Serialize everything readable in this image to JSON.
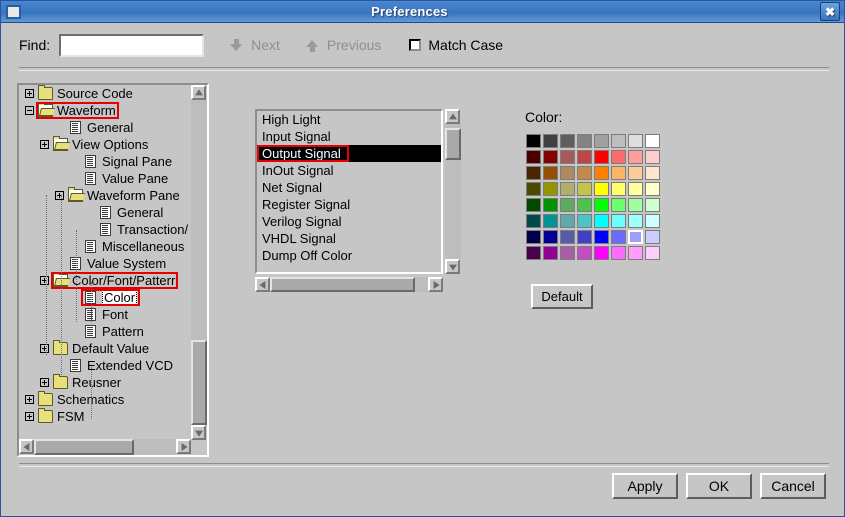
{
  "window": {
    "title": "Preferences",
    "close_label": "✖"
  },
  "findbar": {
    "find_label": "Find:",
    "find_value": "",
    "find_placeholder": "",
    "next_label": "Next",
    "previous_label": "Previous",
    "match_case_label": "Match Case",
    "match_case_checked": false
  },
  "tree": {
    "items": [
      {
        "label": "Source Code",
        "depth": 0,
        "expander": "plus",
        "icon": "folder",
        "selected": false,
        "red_box": false
      },
      {
        "label": "Waveform",
        "depth": 0,
        "expander": "minus",
        "icon": "folderopen",
        "selected": false,
        "red_box": true
      },
      {
        "label": "General",
        "depth": 2,
        "expander": "none",
        "icon": "doc",
        "selected": false,
        "red_box": false
      },
      {
        "label": "View Options",
        "depth": 1,
        "expander": "plus",
        "icon": "folderopen",
        "selected": false,
        "red_box": false
      },
      {
        "label": "Signal Pane",
        "depth": 3,
        "expander": "none",
        "icon": "doc",
        "selected": false,
        "red_box": false
      },
      {
        "label": "Value Pane",
        "depth": 3,
        "expander": "none",
        "icon": "doc",
        "selected": false,
        "red_box": false
      },
      {
        "label": "Waveform Pane",
        "depth": 2,
        "expander": "plus",
        "icon": "folderopen",
        "selected": false,
        "red_box": false
      },
      {
        "label": "General",
        "depth": 4,
        "expander": "none",
        "icon": "doc",
        "selected": false,
        "red_box": false
      },
      {
        "label": "Transaction/",
        "depth": 4,
        "expander": "none",
        "icon": "doc",
        "selected": false,
        "red_box": false
      },
      {
        "label": "Miscellaneous",
        "depth": 3,
        "expander": "none",
        "icon": "doc",
        "selected": false,
        "red_box": false
      },
      {
        "label": "Value System",
        "depth": 2,
        "expander": "none",
        "icon": "doc",
        "selected": false,
        "red_box": false
      },
      {
        "label": "Color/Font/Patterr",
        "depth": 1,
        "expander": "plus",
        "icon": "folderopen",
        "selected": false,
        "red_box": true
      },
      {
        "label": "Color",
        "depth": 3,
        "expander": "none",
        "icon": "doc",
        "selected": true,
        "red_box": true
      },
      {
        "label": "Font",
        "depth": 3,
        "expander": "none",
        "icon": "doc",
        "selected": false,
        "red_box": false
      },
      {
        "label": "Pattern",
        "depth": 3,
        "expander": "none",
        "icon": "doc",
        "selected": false,
        "red_box": false
      },
      {
        "label": "Default Value",
        "depth": 1,
        "expander": "plus",
        "icon": "folder",
        "selected": false,
        "red_box": false
      },
      {
        "label": "Extended VCD",
        "depth": 2,
        "expander": "none",
        "icon": "doc",
        "selected": false,
        "red_box": false
      },
      {
        "label": "Reusner",
        "depth": 1,
        "expander": "plus",
        "icon": "folder",
        "selected": false,
        "red_box": false
      },
      {
        "label": "Schematics",
        "depth": 0,
        "expander": "plus",
        "icon": "folder",
        "selected": false,
        "red_box": false
      },
      {
        "label": "FSM",
        "depth": 0,
        "expander": "plus",
        "icon": "folder",
        "selected": false,
        "red_box": false
      }
    ]
  },
  "list": {
    "items": [
      {
        "label": "High Light",
        "selected": false,
        "red_box": false
      },
      {
        "label": "Input Signal",
        "selected": false,
        "red_box": false
      },
      {
        "label": "Output Signal",
        "selected": true,
        "red_box": true
      },
      {
        "label": "InOut Signal",
        "selected": false,
        "red_box": false
      },
      {
        "label": "Net Signal",
        "selected": false,
        "red_box": false
      },
      {
        "label": "Register Signal",
        "selected": false,
        "red_box": false
      },
      {
        "label": "Verilog Signal",
        "selected": false,
        "red_box": false
      },
      {
        "label": "VHDL Signal",
        "selected": false,
        "red_box": false
      },
      {
        "label": "Dump Off Color",
        "selected": false,
        "red_box": false
      }
    ]
  },
  "color": {
    "label": "Color:",
    "default_button_label": "Default",
    "selected_index": 54,
    "swatches": [
      "#000000",
      "#404040",
      "#5e5e5e",
      "#838383",
      "#a0a0a0",
      "#bdbdbd",
      "#dedede",
      "#ffffff",
      "#4a0000",
      "#870000",
      "#a85a5a",
      "#c04545",
      "#ff0000",
      "#ff6b6b",
      "#ff9e9e",
      "#ffcccc",
      "#4a2600",
      "#944f00",
      "#b08a5e",
      "#c48a4c",
      "#ff8000",
      "#ffb366",
      "#ffcc99",
      "#ffe5cc",
      "#4a4a00",
      "#949400",
      "#b0b06a",
      "#c4c44c",
      "#ffff00",
      "#ffff6b",
      "#ffff9e",
      "#ffffcc",
      "#004a00",
      "#009400",
      "#5eaa5e",
      "#4cc44c",
      "#00ff00",
      "#6bff6b",
      "#9eff9e",
      "#ccffcc",
      "#004a4a",
      "#009494",
      "#5eaaaa",
      "#4cc4c4",
      "#00ffff",
      "#6bffff",
      "#9effff",
      "#ccffff",
      "#00004a",
      "#000094",
      "#5a5aaa",
      "#4040c4",
      "#0000ff",
      "#6b6bff",
      "#9e9eff",
      "#ccccff",
      "#4a004a",
      "#940094",
      "#aa5eaa",
      "#c44cc4",
      "#ff00ff",
      "#ff6bff",
      "#ff9eff",
      "#ffccff"
    ]
  },
  "buttons": {
    "apply_label": "Apply",
    "ok_label": "OK",
    "cancel_label": "Cancel"
  }
}
